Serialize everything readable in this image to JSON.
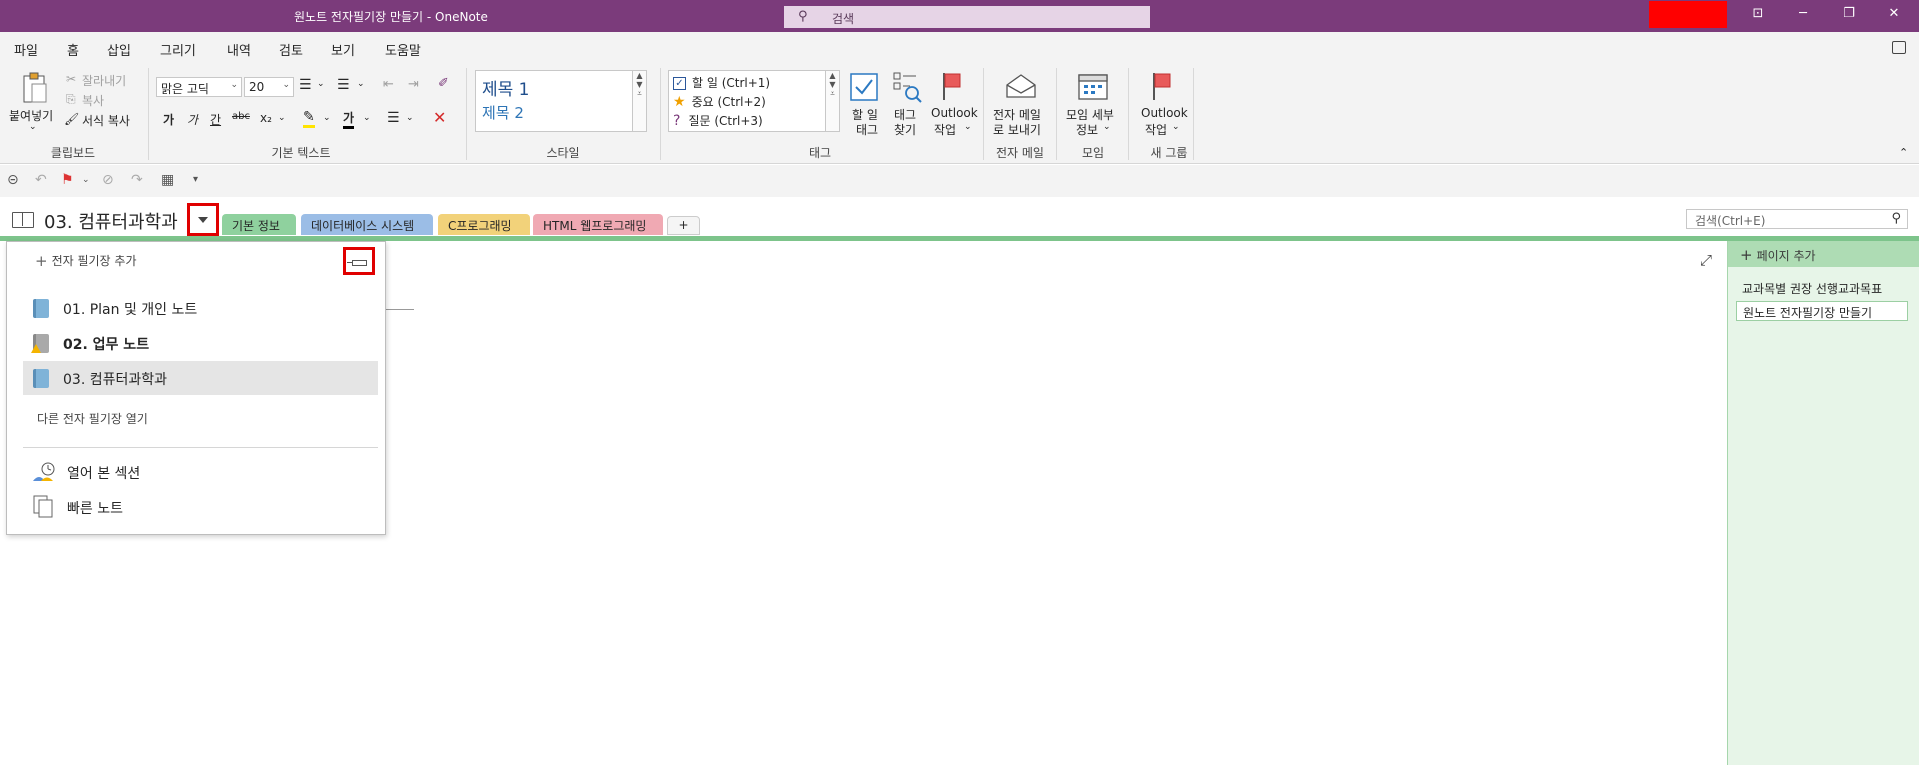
{
  "window": {
    "title": "원노트 전자필기장 만들기  -  OneNote",
    "search_placeholder": "검색"
  },
  "menu": {
    "items": [
      "파일",
      "홈",
      "삽입",
      "그리기",
      "내역",
      "검토",
      "보기",
      "도움말"
    ],
    "active": "홈"
  },
  "ribbon": {
    "clipboard": {
      "paste": "붙여넣기",
      "cut": "잘라내기",
      "copy": "복사",
      "format_painter": "서식 복사",
      "label": "클립보드"
    },
    "basic_text": {
      "font": "맑은 고딕",
      "size": "20",
      "bold": "가",
      "italic": "가",
      "underline": "간",
      "strike": "abc",
      "subscript": "x₂",
      "font_color": "가",
      "label": "기본 텍스트"
    },
    "styles": {
      "h1": "제목 1",
      "h2": "제목 2",
      "label": "스타일"
    },
    "tags": {
      "todo": "할 일 (Ctrl+1)",
      "important": "중요 (Ctrl+2)",
      "question": "질문 (Ctrl+3)",
      "todo_tag_line1": "할 일",
      "todo_tag_line2": "태그",
      "find_tags_line1": "태그",
      "find_tags_line2": "찾기",
      "outlook_tasks_line1": "Outlook",
      "outlook_tasks_line2": "작업",
      "label": "태그"
    },
    "email": {
      "line1": "전자 메일",
      "line2": "로 보내기",
      "label": "전자 메일"
    },
    "meetings": {
      "line1": "모임 세부",
      "line2": "정보",
      "label": "모임"
    },
    "new_group": {
      "line1": "Outlook",
      "line2": "작업",
      "label": "새 그룹"
    }
  },
  "notebook": {
    "title": "03. 컴퓨터과학과",
    "tabs": [
      {
        "label": "기본 정보",
        "color": "#8fd19e"
      },
      {
        "label": "데이터베이스 시스템",
        "color": "#9bbde6"
      },
      {
        "label": "C프로그래밍",
        "color": "#f2d27a"
      },
      {
        "label": "HTML 웹프로그래밍",
        "color": "#f0a9b3"
      }
    ],
    "add_tab": "+",
    "page_search_placeholder": "검색(Ctrl+E)"
  },
  "pages": {
    "add_label": "페이지 추가",
    "items": [
      "교과목별 권장 선행교과목표",
      "원노트 전자필기장 만들기"
    ]
  },
  "flyout": {
    "add_notebook": "전자 필기장 추가",
    "notebooks": [
      "01. Plan 및 개인 노트",
      "02. 업무 노트",
      "03. 컴퓨터과학과"
    ],
    "open_other": "다른 전자 필기장 열기",
    "recent_sections": "열어 본 섹션",
    "quick_notes": "빠른 노트"
  }
}
